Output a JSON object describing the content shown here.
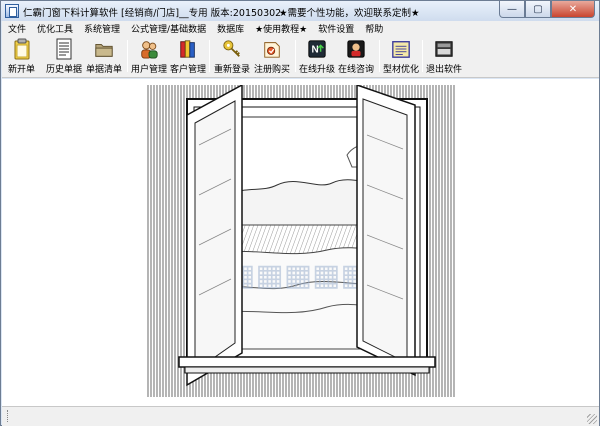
{
  "window": {
    "title": "仁霸门窗下料计算软件 [经销商/门店]__专用 版本:20150302",
    "slogan": "★需要个性功能，欢迎联系定制★",
    "controls": {
      "minimize": "—",
      "maximize": "▢",
      "close": "✕"
    }
  },
  "menu": {
    "items": [
      {
        "label": "文件"
      },
      {
        "label": "优化工具"
      },
      {
        "label": "系统管理"
      },
      {
        "label": "公式管理/基础数据"
      },
      {
        "label": "数据库"
      },
      {
        "label": "★使用教程★"
      },
      {
        "label": "软件设置"
      },
      {
        "label": "帮助"
      }
    ]
  },
  "toolbar": {
    "buttons": [
      {
        "label": "新开单",
        "icon": "clipboard-icon"
      },
      {
        "label": "历史单据",
        "icon": "document-list-icon"
      },
      {
        "label": "单据清单",
        "icon": "folder-icon"
      },
      {
        "label": "用户管理",
        "icon": "users-icon"
      },
      {
        "label": "客户管理",
        "icon": "books-icon"
      },
      {
        "label": "重新登录",
        "icon": "key-icon"
      },
      {
        "label": "注册购买",
        "icon": "register-icon"
      },
      {
        "label": "在线升级",
        "icon": "upgrade-icon"
      },
      {
        "label": "在线咨询",
        "icon": "consult-icon"
      },
      {
        "label": "型材优化",
        "icon": "optimize-icon"
      },
      {
        "label": "退出软件",
        "icon": "exit-icon"
      }
    ]
  },
  "colors": {
    "frame": "#dbe6f4",
    "toolbar_bg": "#f0f0f0",
    "close_button": "#c9452f",
    "watermark": "#9fb3cf"
  }
}
